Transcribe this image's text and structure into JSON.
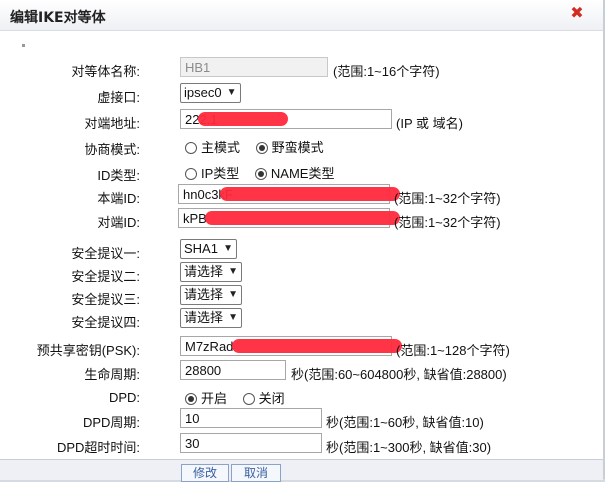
{
  "dialog": {
    "title": "编辑IKE对等体"
  },
  "fields": {
    "peer_name": {
      "label": "对等体名称:",
      "value": "HB1",
      "hint": "(范围:1~16个字符)"
    },
    "virtual_iface": {
      "label": "虚接口:",
      "selected": "ipsec0"
    },
    "peer_address": {
      "label": "对端地址:",
      "value": "222.1",
      "hint": "(IP 或 域名)"
    },
    "negotiation_mode": {
      "label": "协商模式:",
      "options": [
        "主模式",
        "野蛮模式"
      ],
      "selected": "野蛮模式"
    },
    "id_type": {
      "label": "ID类型:",
      "options": [
        "IP类型",
        "NAME类型"
      ],
      "selected": "NAME类型"
    },
    "local_id": {
      "label": "本端ID:",
      "value": "hn0c3kF",
      "hint": "(范围:1~32个字符)"
    },
    "peer_id": {
      "label": "对端ID:",
      "value": "kPB",
      "hint": "(范围:1~32个字符)"
    },
    "proposal_1": {
      "label": "安全提议一:",
      "selected": "SHA1"
    },
    "proposal_2": {
      "label": "安全提议二:",
      "selected": "请选择"
    },
    "proposal_3": {
      "label": "安全提议三:",
      "selected": "请选择"
    },
    "proposal_4": {
      "label": "安全提议四:",
      "selected": "请选择"
    },
    "psk": {
      "label": "预共享密钥(PSK):",
      "value": "M7zRad",
      "hint": "(范围:1~128个字符)"
    },
    "lifetime": {
      "label": "生命周期:",
      "value": "28800",
      "hint": "秒(范围:60~604800秒, 缺省值:28800)"
    },
    "dpd": {
      "label": "DPD:",
      "options": [
        "开启",
        "关闭"
      ],
      "selected": "开启"
    },
    "dpd_period": {
      "label": "DPD周期:",
      "value": "10",
      "hint": "秒(范围:1~60秒, 缺省值:10)"
    },
    "dpd_timeout": {
      "label": "DPD超时时间:",
      "value": "30",
      "hint": "秒(范围:1~300秒, 缺省值:30)"
    }
  },
  "buttons": {
    "modify": "修改",
    "cancel": "取消"
  },
  "colors": {
    "close": "#d22b1f",
    "redaction": "#ff2a3d",
    "button_text": "#3a5f9f"
  }
}
